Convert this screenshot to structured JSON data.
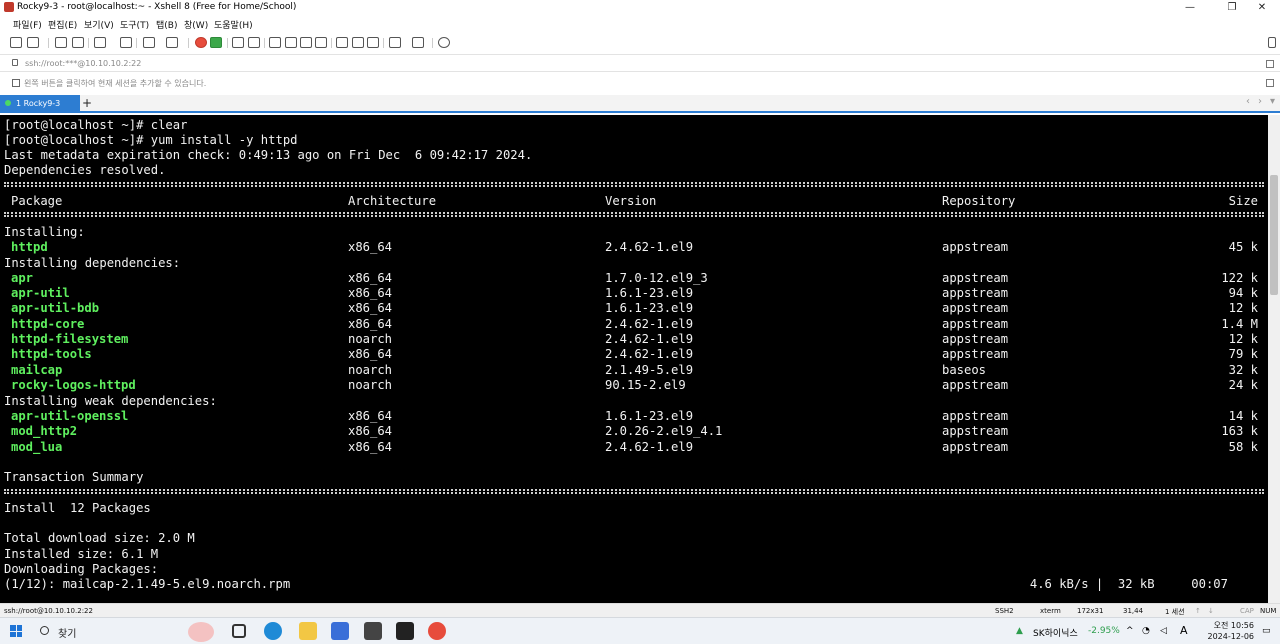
{
  "window": {
    "title": "Rocky9-3 - root@localhost:~ - Xshell 8 (Free for Home/School)"
  },
  "menu": [
    "파일(F)",
    "편집(E)",
    "보기(V)",
    "도구(T)",
    "탭(B)",
    "창(W)",
    "도움말(H)"
  ],
  "address": {
    "value": "ssh://root:***@10.10.10.2:22"
  },
  "hint": {
    "text": "왼쪽 버튼을 클릭하여 현재 세션을 추가할 수 있습니다."
  },
  "tab": {
    "label": "1 Rocky9-3",
    "new_tab": "+"
  },
  "terminal": {
    "prompt_lines": [
      "[root@localhost ~]# clear",
      "[root@localhost ~]# yum install -y httpd",
      "Last metadata expiration check: 0:49:13 ago on Fri Dec  6 09:42:17 2024.",
      "Dependencies resolved."
    ],
    "headers": {
      "package": "Package",
      "arch": "Architecture",
      "version": "Version",
      "repo": "Repository",
      "size": "Size"
    },
    "sections": {
      "installing": "Installing:",
      "deps": "Installing dependencies:",
      "weak": "Installing weak dependencies:"
    },
    "rows": [
      {
        "name": "httpd",
        "arch": "x86_64",
        "version": "2.4.62-1.el9",
        "repo": "appstream",
        "size": "45 k"
      },
      {
        "name": "apr",
        "arch": "x86_64",
        "version": "1.7.0-12.el9_3",
        "repo": "appstream",
        "size": "122 k"
      },
      {
        "name": "apr-util",
        "arch": "x86_64",
        "version": "1.6.1-23.el9",
        "repo": "appstream",
        "size": "94 k"
      },
      {
        "name": "apr-util-bdb",
        "arch": "x86_64",
        "version": "1.6.1-23.el9",
        "repo": "appstream",
        "size": "12 k"
      },
      {
        "name": "httpd-core",
        "arch": "x86_64",
        "version": "2.4.62-1.el9",
        "repo": "appstream",
        "size": "1.4 M"
      },
      {
        "name": "httpd-filesystem",
        "arch": "noarch",
        "version": "2.4.62-1.el9",
        "repo": "appstream",
        "size": "12 k"
      },
      {
        "name": "httpd-tools",
        "arch": "x86_64",
        "version": "2.4.62-1.el9",
        "repo": "appstream",
        "size": "79 k"
      },
      {
        "name": "mailcap",
        "arch": "noarch",
        "version": "2.1.49-5.el9",
        "repo": "baseos",
        "size": "32 k"
      },
      {
        "name": "rocky-logos-httpd",
        "arch": "noarch",
        "version": "90.15-2.el9",
        "repo": "appstream",
        "size": "24 k"
      },
      {
        "name": "apr-util-openssl",
        "arch": "x86_64",
        "version": "1.6.1-23.el9",
        "repo": "appstream",
        "size": "14 k"
      },
      {
        "name": "mod_http2",
        "arch": "x86_64",
        "version": "2.0.26-2.el9_4.1",
        "repo": "appstream",
        "size": "163 k"
      },
      {
        "name": "mod_lua",
        "arch": "x86_64",
        "version": "2.4.62-1.el9",
        "repo": "appstream",
        "size": "58 k"
      }
    ],
    "summary_title": "Transaction Summary",
    "install_line": "Install  12 Packages",
    "download_size": "Total download size: 2.0 M",
    "installed_size": "Installed size: 6.1 M",
    "downloading": "Downloading Packages:",
    "progress_file": "(1/12): mailcap-2.1.49-5.el9.noarch.rpm",
    "progress_stats": "4.6 kB/s |  32 kB     00:07"
  },
  "status": {
    "session": "ssh://root@10.10.10.2:22",
    "protocol": "SSH2",
    "term": "xterm",
    "size": "172x31",
    "cursor": "31,44",
    "sessions": "1 세션",
    "cap": "CAP",
    "num": "NUM"
  },
  "taskbar": {
    "search": "찾기",
    "stock_name": "SK하이닉스",
    "stock_change": "-2.95%",
    "ime": "A",
    "time": "오전 10:56",
    "date": "2024-12-06"
  },
  "colors": {
    "accent": "#2d7dd2",
    "package_green": "#5ff05f",
    "stock_down": "#2e9e4e"
  }
}
